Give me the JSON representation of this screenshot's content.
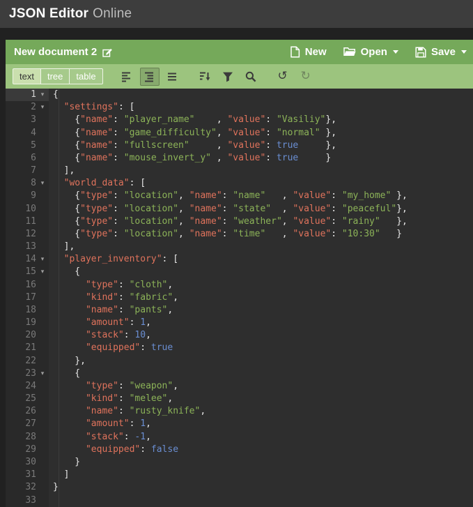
{
  "header": {
    "title_primary": "JSON Editor",
    "title_secondary": "Online"
  },
  "document_bar": {
    "document_name": "New document 2",
    "rename_icon": "edit-pencil-icon",
    "actions": [
      {
        "name": "new-document-button",
        "label": "New",
        "icon": "new-doc-icon",
        "dropdown": false
      },
      {
        "name": "open-button",
        "label": "Open",
        "icon": "folder-open-icon",
        "dropdown": true
      },
      {
        "name": "save-button",
        "label": "Save",
        "icon": "save-icon",
        "dropdown": true
      }
    ]
  },
  "menubar": {
    "modes": [
      {
        "name": "mode-text-button",
        "label": "text",
        "active": true
      },
      {
        "name": "mode-tree-button",
        "label": "tree",
        "active": false
      },
      {
        "name": "mode-table-button",
        "label": "table",
        "active": false
      }
    ],
    "tools": [
      {
        "name": "format-button",
        "icon": "align-left-icon",
        "group": 1,
        "state": "normal"
      },
      {
        "name": "compact-button",
        "icon": "indent-lines-icon",
        "group": 1,
        "state": "active"
      },
      {
        "name": "justify-button",
        "icon": "justify-lines-icon",
        "group": 1,
        "state": "normal"
      },
      {
        "name": "sort-button",
        "icon": "sort-icon",
        "group": 2,
        "state": "normal"
      },
      {
        "name": "transform-button",
        "icon": "filter-icon",
        "group": 2,
        "state": "normal"
      },
      {
        "name": "search-button",
        "icon": "search-icon",
        "group": 2,
        "state": "normal"
      },
      {
        "name": "undo-button",
        "icon": "undo-icon",
        "group": 3,
        "state": "normal"
      },
      {
        "name": "redo-button",
        "icon": "redo-icon",
        "group": 3,
        "state": "disabled"
      }
    ]
  },
  "theme": {
    "header_bg": "#3d3d3d",
    "page_bg": "#212121",
    "toolbar_green": "#75a95a",
    "menubar_green": "#9cc47e",
    "editor_bg": "#2e2e2e",
    "gutter_bg": "#292929",
    "line_number": "#7a7a7a",
    "syntax_key": "#e0735c",
    "syntax_string": "#8cb358",
    "syntax_number": "#6a8ed2",
    "syntax_punct": "#e8e8e8"
  },
  "editor": {
    "lines": [
      {
        "n": 1,
        "fold": true,
        "active": true,
        "t": [
          [
            "p",
            "{"
          ]
        ]
      },
      {
        "n": 2,
        "fold": true,
        "t": [
          [
            "p",
            "  "
          ],
          [
            "k",
            "\"settings\""
          ],
          [
            "p",
            ": ["
          ]
        ]
      },
      {
        "n": 3,
        "t": [
          [
            "p",
            "    {"
          ],
          [
            "k",
            "\"name\""
          ],
          [
            "p",
            ": "
          ],
          [
            "s",
            "\"player_name\""
          ],
          [
            "p",
            "    , "
          ],
          [
            "k",
            "\"value\""
          ],
          [
            "p",
            ": "
          ],
          [
            "s",
            "\"Vasiliy\""
          ],
          [
            "p",
            "},"
          ]
        ]
      },
      {
        "n": 4,
        "t": [
          [
            "p",
            "    {"
          ],
          [
            "k",
            "\"name\""
          ],
          [
            "p",
            ": "
          ],
          [
            "s",
            "\"game_difficulty\""
          ],
          [
            "p",
            ", "
          ],
          [
            "k",
            "\"value\""
          ],
          [
            "p",
            ": "
          ],
          [
            "s",
            "\"normal\""
          ],
          [
            "p",
            " },"
          ]
        ]
      },
      {
        "n": 5,
        "t": [
          [
            "p",
            "    {"
          ],
          [
            "k",
            "\"name\""
          ],
          [
            "p",
            ": "
          ],
          [
            "s",
            "\"fullscreen\""
          ],
          [
            "p",
            "     , "
          ],
          [
            "k",
            "\"value\""
          ],
          [
            "p",
            ": "
          ],
          [
            "b",
            "true"
          ],
          [
            "p",
            "     },"
          ]
        ]
      },
      {
        "n": 6,
        "t": [
          [
            "p",
            "    {"
          ],
          [
            "k",
            "\"name\""
          ],
          [
            "p",
            ": "
          ],
          [
            "s",
            "\"mouse_invert_y\""
          ],
          [
            "p",
            " , "
          ],
          [
            "k",
            "\"value\""
          ],
          [
            "p",
            ": "
          ],
          [
            "b",
            "true"
          ],
          [
            "p",
            "     }"
          ]
        ]
      },
      {
        "n": 7,
        "t": [
          [
            "p",
            "  ],"
          ]
        ]
      },
      {
        "n": 8,
        "fold": true,
        "t": [
          [
            "p",
            "  "
          ],
          [
            "k",
            "\"world_data\""
          ],
          [
            "p",
            ": ["
          ]
        ]
      },
      {
        "n": 9,
        "t": [
          [
            "p",
            "    {"
          ],
          [
            "k",
            "\"type\""
          ],
          [
            "p",
            ": "
          ],
          [
            "s",
            "\"location\""
          ],
          [
            "p",
            ", "
          ],
          [
            "k",
            "\"name\""
          ],
          [
            "p",
            ": "
          ],
          [
            "s",
            "\"name\""
          ],
          [
            "p",
            "   , "
          ],
          [
            "k",
            "\"value\""
          ],
          [
            "p",
            ": "
          ],
          [
            "s",
            "\"my_home\""
          ],
          [
            "p",
            " },"
          ]
        ]
      },
      {
        "n": 10,
        "t": [
          [
            "p",
            "    {"
          ],
          [
            "k",
            "\"type\""
          ],
          [
            "p",
            ": "
          ],
          [
            "s",
            "\"location\""
          ],
          [
            "p",
            ", "
          ],
          [
            "k",
            "\"name\""
          ],
          [
            "p",
            ": "
          ],
          [
            "s",
            "\"state\""
          ],
          [
            "p",
            "  , "
          ],
          [
            "k",
            "\"value\""
          ],
          [
            "p",
            ": "
          ],
          [
            "s",
            "\"peaceful\""
          ],
          [
            "p",
            "},"
          ]
        ]
      },
      {
        "n": 11,
        "t": [
          [
            "p",
            "    {"
          ],
          [
            "k",
            "\"type\""
          ],
          [
            "p",
            ": "
          ],
          [
            "s",
            "\"location\""
          ],
          [
            "p",
            ", "
          ],
          [
            "k",
            "\"name\""
          ],
          [
            "p",
            ": "
          ],
          [
            "s",
            "\"weather\""
          ],
          [
            "p",
            ", "
          ],
          [
            "k",
            "\"value\""
          ],
          [
            "p",
            ": "
          ],
          [
            "s",
            "\"rainy\""
          ],
          [
            "p",
            "   },"
          ]
        ]
      },
      {
        "n": 12,
        "t": [
          [
            "p",
            "    {"
          ],
          [
            "k",
            "\"type\""
          ],
          [
            "p",
            ": "
          ],
          [
            "s",
            "\"location\""
          ],
          [
            "p",
            ", "
          ],
          [
            "k",
            "\"name\""
          ],
          [
            "p",
            ": "
          ],
          [
            "s",
            "\"time\""
          ],
          [
            "p",
            "   , "
          ],
          [
            "k",
            "\"value\""
          ],
          [
            "p",
            ": "
          ],
          [
            "s",
            "\"10:30\""
          ],
          [
            "p",
            "   }"
          ]
        ]
      },
      {
        "n": 13,
        "t": [
          [
            "p",
            "  ],"
          ]
        ]
      },
      {
        "n": 14,
        "fold": true,
        "t": [
          [
            "p",
            "  "
          ],
          [
            "k",
            "\"player_inventory\""
          ],
          [
            "p",
            ": ["
          ]
        ]
      },
      {
        "n": 15,
        "fold": true,
        "t": [
          [
            "p",
            "    {"
          ]
        ]
      },
      {
        "n": 16,
        "t": [
          [
            "p",
            "      "
          ],
          [
            "k",
            "\"type\""
          ],
          [
            "p",
            ": "
          ],
          [
            "s",
            "\"cloth\""
          ],
          [
            "p",
            ","
          ]
        ]
      },
      {
        "n": 17,
        "t": [
          [
            "p",
            "      "
          ],
          [
            "k",
            "\"kind\""
          ],
          [
            "p",
            ": "
          ],
          [
            "s",
            "\"fabric\""
          ],
          [
            "p",
            ","
          ]
        ]
      },
      {
        "n": 18,
        "t": [
          [
            "p",
            "      "
          ],
          [
            "k",
            "\"name\""
          ],
          [
            "p",
            ": "
          ],
          [
            "s",
            "\"pants\""
          ],
          [
            "p",
            ","
          ]
        ]
      },
      {
        "n": 19,
        "t": [
          [
            "p",
            "      "
          ],
          [
            "k",
            "\"amount\""
          ],
          [
            "p",
            ": "
          ],
          [
            "b",
            "1"
          ],
          [
            "p",
            ","
          ]
        ]
      },
      {
        "n": 20,
        "t": [
          [
            "p",
            "      "
          ],
          [
            "k",
            "\"stack\""
          ],
          [
            "p",
            ": "
          ],
          [
            "b",
            "10"
          ],
          [
            "p",
            ","
          ]
        ]
      },
      {
        "n": 21,
        "t": [
          [
            "p",
            "      "
          ],
          [
            "k",
            "\"equipped\""
          ],
          [
            "p",
            ": "
          ],
          [
            "b",
            "true"
          ]
        ]
      },
      {
        "n": 22,
        "t": [
          [
            "p",
            "    },"
          ]
        ]
      },
      {
        "n": 23,
        "fold": true,
        "t": [
          [
            "p",
            "    {"
          ]
        ]
      },
      {
        "n": 24,
        "t": [
          [
            "p",
            "      "
          ],
          [
            "k",
            "\"type\""
          ],
          [
            "p",
            ": "
          ],
          [
            "s",
            "\"weapon\""
          ],
          [
            "p",
            ","
          ]
        ]
      },
      {
        "n": 25,
        "t": [
          [
            "p",
            "      "
          ],
          [
            "k",
            "\"kind\""
          ],
          [
            "p",
            ": "
          ],
          [
            "s",
            "\"melee\""
          ],
          [
            "p",
            ","
          ]
        ]
      },
      {
        "n": 26,
        "t": [
          [
            "p",
            "      "
          ],
          [
            "k",
            "\"name\""
          ],
          [
            "p",
            ": "
          ],
          [
            "s",
            "\"rusty_knife\""
          ],
          [
            "p",
            ","
          ]
        ]
      },
      {
        "n": 27,
        "t": [
          [
            "p",
            "      "
          ],
          [
            "k",
            "\"amount\""
          ],
          [
            "p",
            ": "
          ],
          [
            "b",
            "1"
          ],
          [
            "p",
            ","
          ]
        ]
      },
      {
        "n": 28,
        "t": [
          [
            "p",
            "      "
          ],
          [
            "k",
            "\"stack\""
          ],
          [
            "p",
            ": "
          ],
          [
            "b",
            "-1"
          ],
          [
            "p",
            ","
          ]
        ]
      },
      {
        "n": 29,
        "t": [
          [
            "p",
            "      "
          ],
          [
            "k",
            "\"equipped\""
          ],
          [
            "p",
            ": "
          ],
          [
            "b",
            "false"
          ]
        ]
      },
      {
        "n": 30,
        "t": [
          [
            "p",
            "    }"
          ]
        ]
      },
      {
        "n": 31,
        "t": [
          [
            "p",
            "  ]"
          ]
        ]
      },
      {
        "n": 32,
        "t": [
          [
            "p",
            "}"
          ]
        ]
      },
      {
        "n": 33,
        "t": []
      }
    ]
  }
}
